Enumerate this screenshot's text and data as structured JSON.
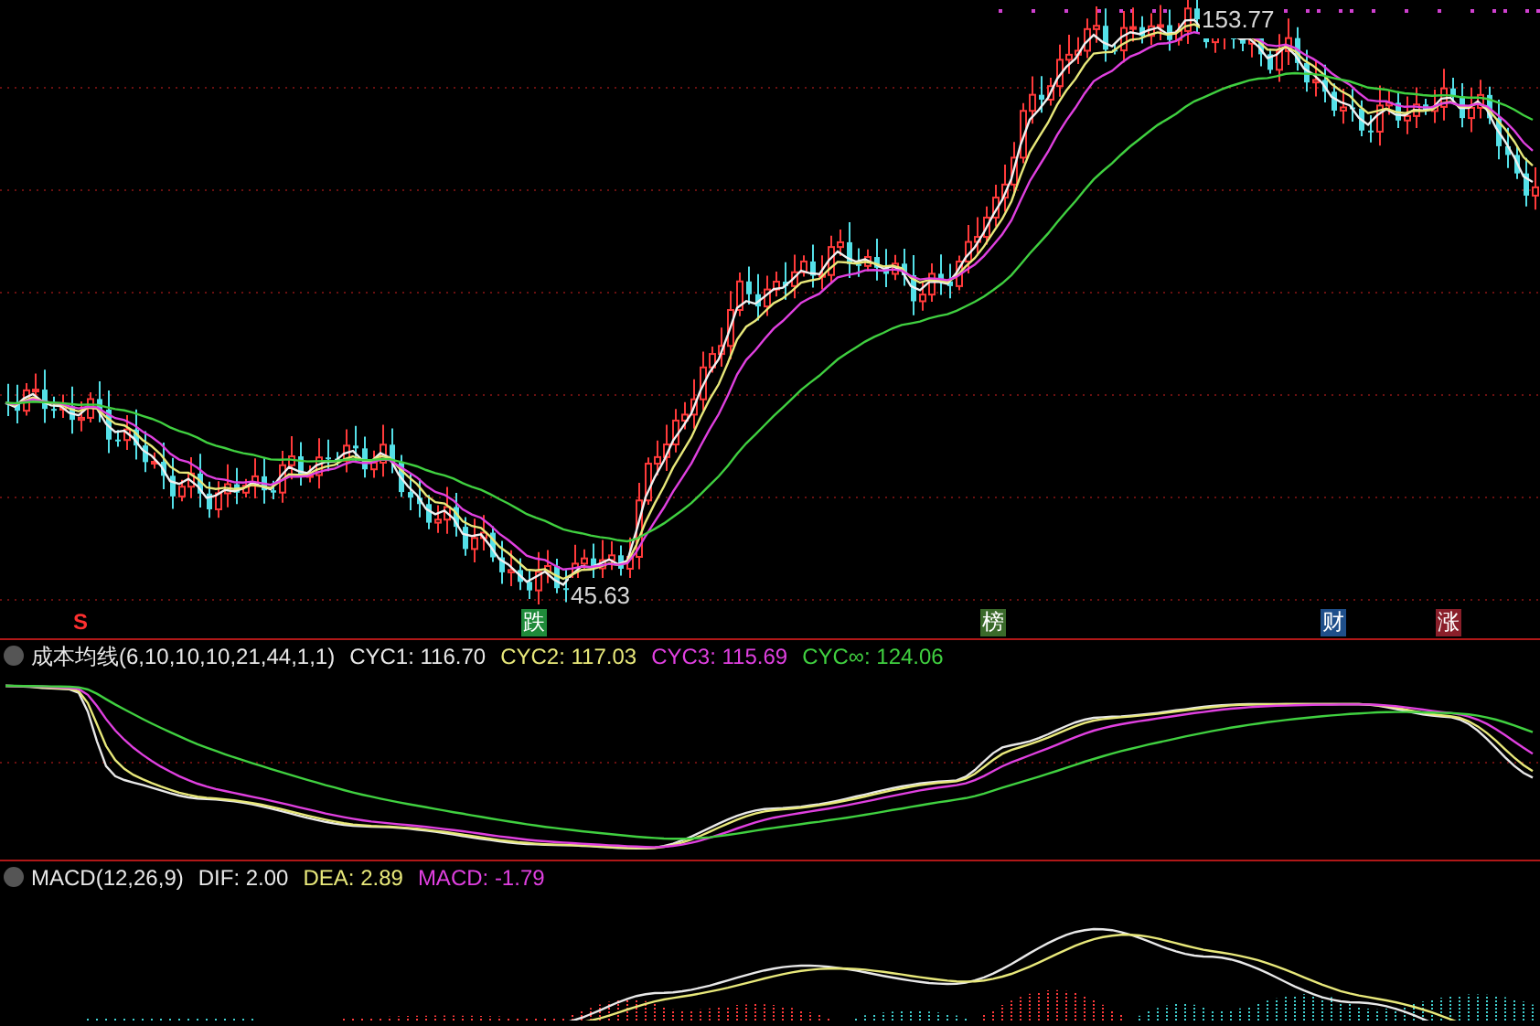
{
  "price_panel": {
    "high_label": "153.77",
    "low_label": "45.63",
    "markers": [
      {
        "text": "S",
        "color": "#000000",
        "kind": "plain"
      },
      {
        "text": "跌",
        "color": "#1f8a3a",
        "kind": "boxed"
      },
      {
        "text": "榜",
        "color": "#3a6a2a",
        "kind": "boxed"
      },
      {
        "text": "财",
        "color": "#1f4f8a",
        "kind": "boxed"
      },
      {
        "text": "涨",
        "color": "#8a1f2a",
        "kind": "boxed"
      }
    ]
  },
  "cost_ma_panel": {
    "title": "成本均线(6,10,10,10,21,44,1,1)",
    "values": [
      {
        "label": "CYC1: 116.70",
        "color": "#e8e8e8"
      },
      {
        "label": "CYC2: 117.03",
        "color": "#e8e87a"
      },
      {
        "label": "CYC3: 115.69",
        "color": "#e040e0"
      },
      {
        "label": "CYC∞: 124.06",
        "color": "#40d040"
      }
    ]
  },
  "macd_panel": {
    "title": "MACD(12,26,9)",
    "values": [
      {
        "label": "DIF: 2.00",
        "color": "#e8e8e8"
      },
      {
        "label": "DEA: 2.89",
        "color": "#e8e87a"
      },
      {
        "label": "MACD: -1.79",
        "color": "#e040e0"
      }
    ]
  }
}
